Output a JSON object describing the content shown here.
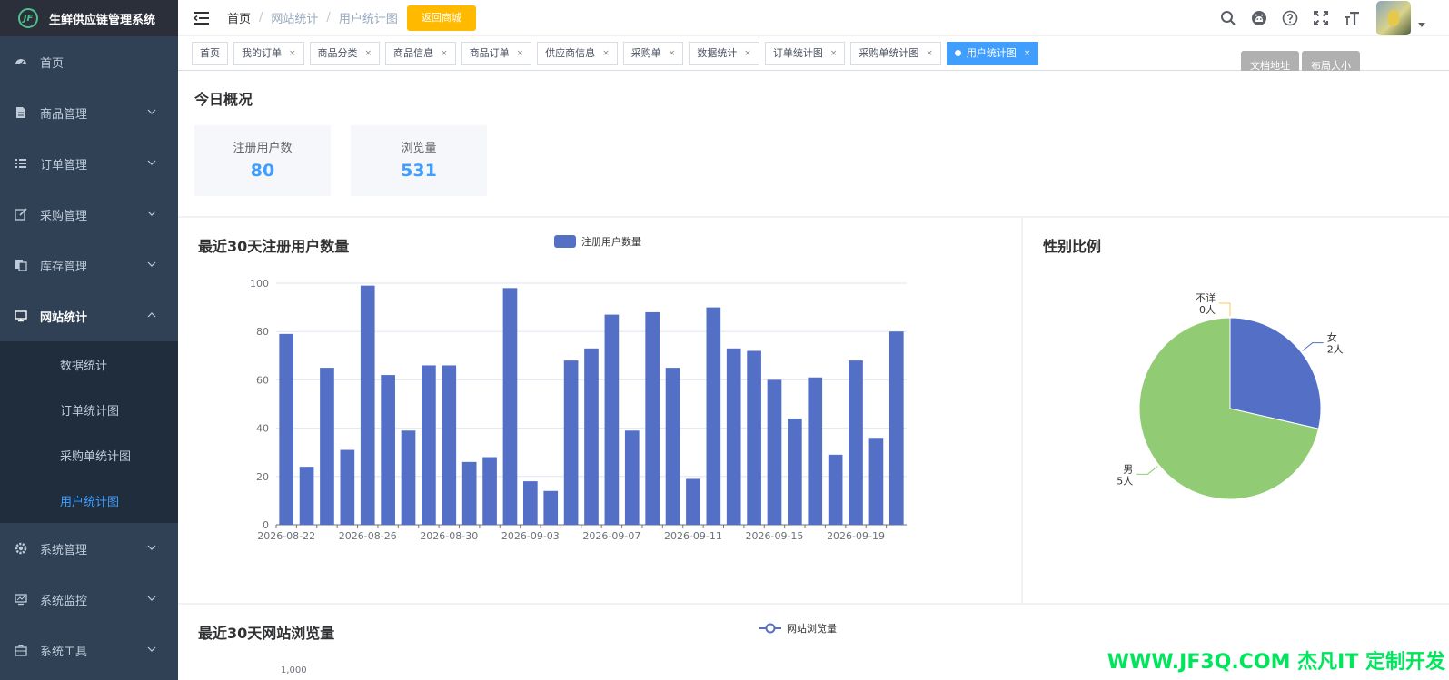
{
  "app": {
    "title": "生鲜供应链管理系统",
    "logo_text": "JF"
  },
  "sidebar": {
    "items": [
      {
        "label": "首页",
        "icon": "dashboard-icon"
      },
      {
        "label": "商品管理",
        "icon": "document-icon"
      },
      {
        "label": "订单管理",
        "icon": "list-icon"
      },
      {
        "label": "采购管理",
        "icon": "edit-icon"
      },
      {
        "label": "库存管理",
        "icon": "copy-icon"
      },
      {
        "label": "网站统计",
        "icon": "monitor-icon"
      }
    ],
    "stats_submenu": [
      "数据统计",
      "订单统计图",
      "采购单统计图",
      "用户统计图"
    ],
    "items_after": [
      {
        "label": "系统管理",
        "icon": "gear-icon"
      },
      {
        "label": "系统监控",
        "icon": "monitor-chart-icon"
      },
      {
        "label": "系统工具",
        "icon": "toolbox-icon"
      }
    ]
  },
  "navbar": {
    "breadcrumb": [
      "首页",
      "网站统计",
      "用户统计图"
    ],
    "back_button": "返回商城",
    "tooltips": {
      "docs": "文档地址",
      "size": "布局大小"
    }
  },
  "tags": [
    {
      "label": "首页",
      "closable": false
    },
    {
      "label": "我的订单",
      "closable": true
    },
    {
      "label": "商品分类",
      "closable": true
    },
    {
      "label": "商品信息",
      "closable": true
    },
    {
      "label": "商品订单",
      "closable": true
    },
    {
      "label": "供应商信息",
      "closable": true
    },
    {
      "label": "采购单",
      "closable": true
    },
    {
      "label": "数据统计",
      "closable": true
    },
    {
      "label": "订单统计图",
      "closable": true
    },
    {
      "label": "采购单统计图",
      "closable": true
    },
    {
      "label": "用户统计图",
      "closable": true,
      "active": true
    }
  ],
  "tag_close_glyph": "×",
  "overview": {
    "title": "今日概况",
    "stats": [
      {
        "label": "注册用户数",
        "value": "80"
      },
      {
        "label": "浏览量",
        "value": "531"
      }
    ]
  },
  "register_panel": {
    "title": "最近30天注册用户数量"
  },
  "gender_panel": {
    "title": "性别比例"
  },
  "views_panel": {
    "title": "最近30天网站浏览量",
    "legend": "网站浏览量",
    "partial_tick": "1,000"
  },
  "watermark": "WWW.JF3Q.COM 杰凡IT  定制开发",
  "colors": {
    "accent": "#409eff",
    "bar": "#5470c6",
    "pie_green": "#91cc75",
    "sidebar": "#304156",
    "back_button": "#ffba00"
  },
  "chart_data": [
    {
      "type": "bar",
      "title": "最近30天注册用户数量",
      "categories": [
        "2026-08-22",
        "2026-08-23",
        "2026-08-24",
        "2026-08-25",
        "2026-08-26",
        "2026-08-27",
        "2026-08-28",
        "2026-08-29",
        "2026-08-30",
        "2026-08-31",
        "2026-09-01",
        "2026-09-02",
        "2026-09-03",
        "2026-09-04",
        "2026-09-05",
        "2026-09-06",
        "2026-09-07",
        "2026-09-08",
        "2026-09-09",
        "2026-09-10",
        "2026-09-11",
        "2026-09-12",
        "2026-09-13",
        "2026-09-14",
        "2026-09-15",
        "2026-09-16",
        "2026-09-17",
        "2026-09-18",
        "2026-09-19",
        "2026-09-20",
        "2026-09-21"
      ],
      "x_tick_labels": [
        "2026-08-22",
        "2026-08-26",
        "2026-08-30",
        "2026-09-03",
        "2026-09-07",
        "2026-09-11",
        "2026-09-15",
        "2026-09-19"
      ],
      "series": [
        {
          "name": "注册用户数量",
          "values": [
            79,
            24,
            65,
            31,
            99,
            62,
            39,
            66,
            66,
            26,
            28,
            98,
            18,
            14,
            68,
            73,
            87,
            39,
            88,
            65,
            19,
            90,
            73,
            72,
            60,
            44,
            61,
            29,
            68,
            36,
            80
          ]
        }
      ],
      "ylim": [
        0,
        100
      ],
      "y_ticks": [
        "0",
        "20",
        "40",
        "60",
        "80",
        "100"
      ],
      "grid": true,
      "legend_position": "top-center"
    },
    {
      "type": "pie",
      "title": "性别比例",
      "slices": [
        {
          "name": "女",
          "value": 2,
          "label": "2人",
          "color": "#5470c6"
        },
        {
          "name": "男",
          "value": 5,
          "label": "5人",
          "color": "#91cc75"
        },
        {
          "name": "不详",
          "value": 0,
          "label": "0人",
          "color": "#fac858"
        }
      ]
    }
  ]
}
